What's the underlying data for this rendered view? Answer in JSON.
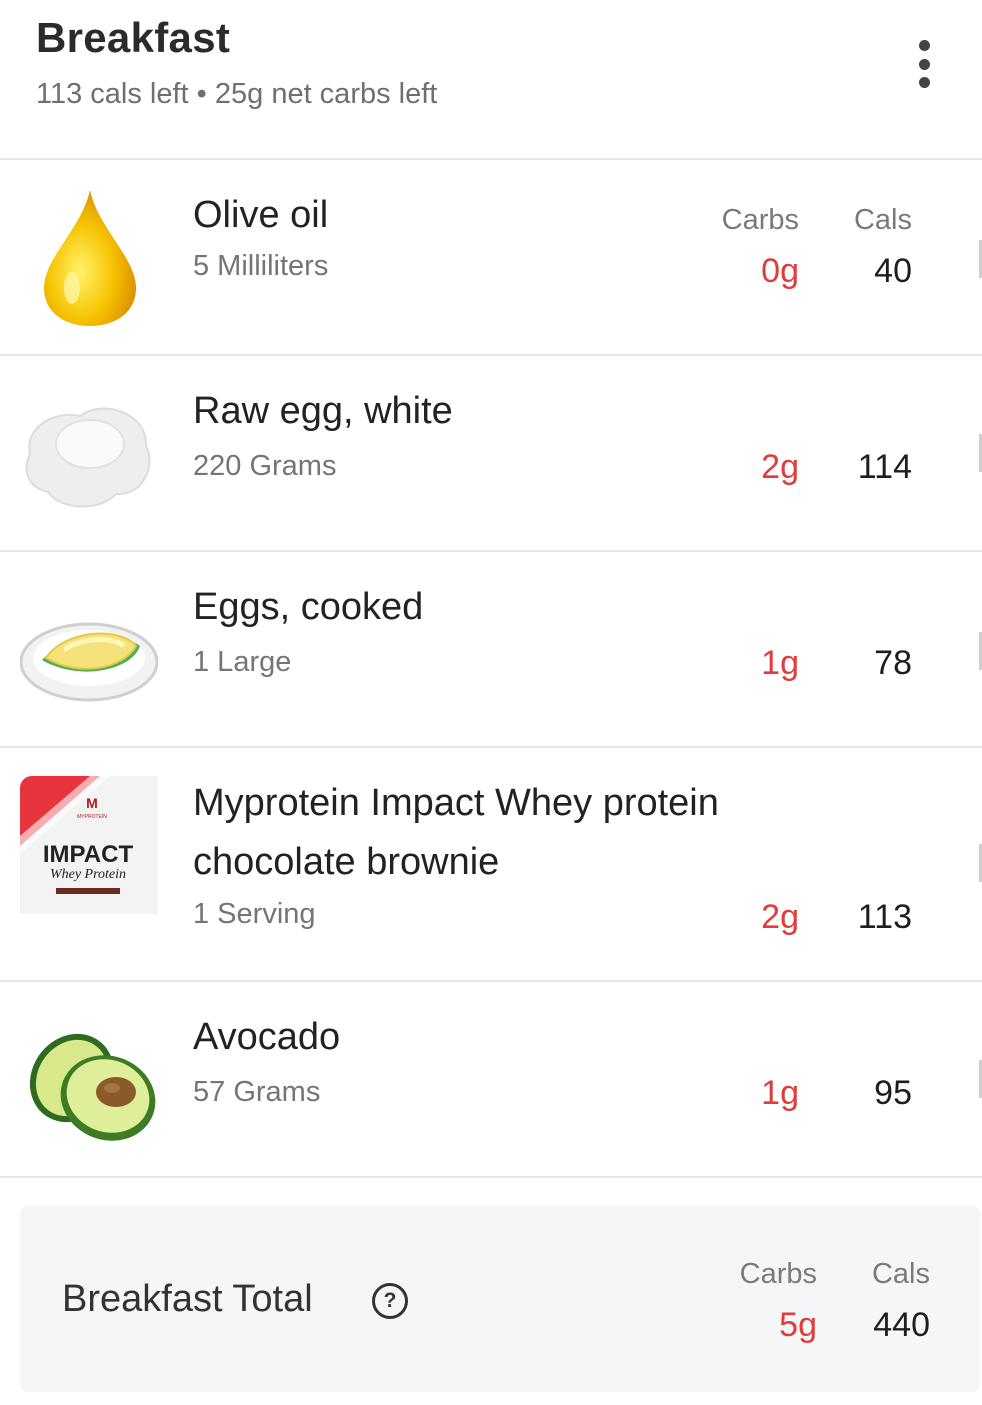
{
  "meal": {
    "title": "Breakfast",
    "summary": "113 cals left • 25g net carbs left"
  },
  "columns": {
    "carbs": "Carbs",
    "cals": "Cals"
  },
  "items": [
    {
      "name": "Olive oil",
      "serving": "5 Milliliters",
      "carbs": "0g",
      "cals": "40",
      "image": "olive-oil-drop"
    },
    {
      "name": "Raw egg, white",
      "serving": "220 Grams",
      "carbs": "2g",
      "cals": "114",
      "image": "egg-white"
    },
    {
      "name": "Eggs, cooked",
      "serving": "1 Large",
      "carbs": "1g",
      "cals": "78",
      "image": "omelette-plate"
    },
    {
      "name": "Myprotein Impact Whey protein chocolate brownie",
      "serving": "1 Serving",
      "carbs": "2g",
      "cals": "113",
      "image": "protein-pouch",
      "packaging": {
        "brand": "MYPROTEIN",
        "product": "IMPACT",
        "subtitle": "Whey Protein"
      }
    },
    {
      "name": "Avocado",
      "serving": "57 Grams",
      "carbs": "1g",
      "cals": "95",
      "image": "avocado-halves"
    }
  ],
  "total": {
    "label": "Breakfast Total",
    "help_icon": "?",
    "carbs_header": "Carbs",
    "cals_header": "Cals",
    "carbs": "5g",
    "cals": "440"
  },
  "colors": {
    "carbs": "#e23b3b",
    "accent_red": "#e8343c",
    "background": "#ffffff",
    "total_bg": "#f5f6f8"
  }
}
